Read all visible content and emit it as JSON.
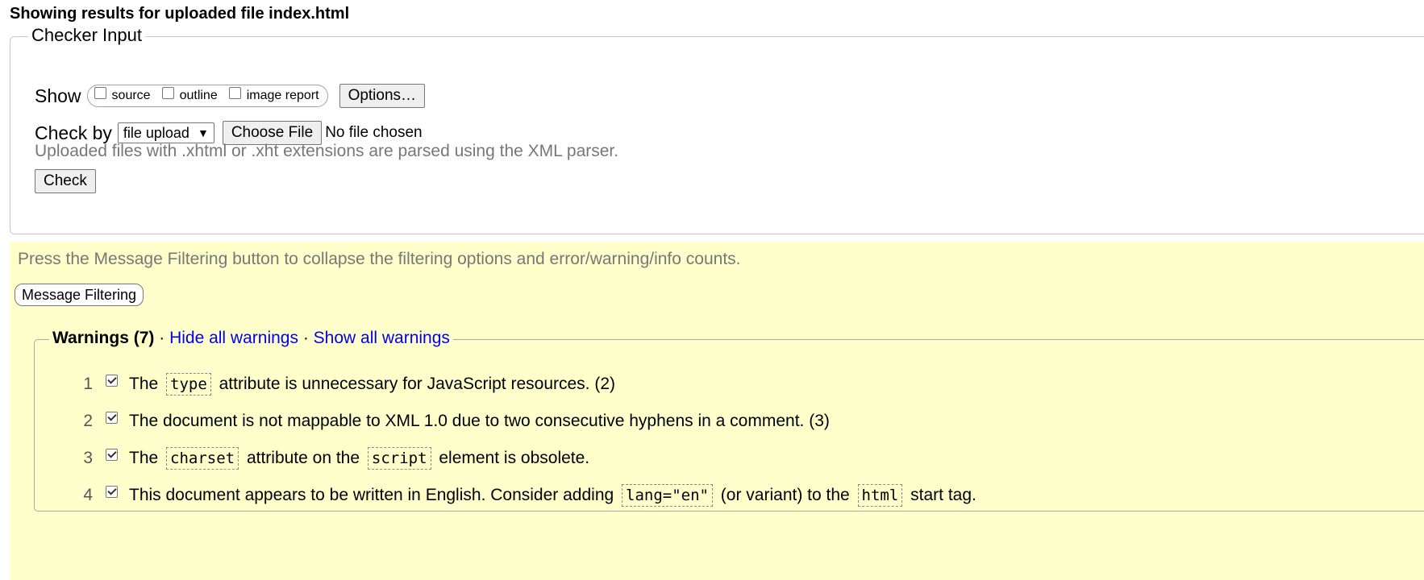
{
  "page": {
    "title_prefix": "Showing results for uploaded file index.html"
  },
  "checker": {
    "legend": "Checker Input",
    "show_label": "Show",
    "show_options": [
      {
        "label": "source",
        "checked": false
      },
      {
        "label": "outline",
        "checked": false
      },
      {
        "label": "image report",
        "checked": false
      }
    ],
    "options_button": "Options…",
    "check_by_label": "Check by",
    "check_by_value": "file upload",
    "choose_file_button": "Choose File",
    "no_file_text": "No file chosen",
    "hint": "Uploaded files with .xhtml or .xht extensions are parsed using the XML parser.",
    "check_button": "Check"
  },
  "filter": {
    "hint": "Press the Message Filtering button to collapse the filtering options and error/warning/info counts.",
    "button": "Message Filtering",
    "warnings_heading": "Warnings (7)",
    "separator": " · ",
    "hide_all": "Hide all warnings",
    "show_all": "Show all warnings",
    "messages": [
      {
        "num": "1",
        "checked": true,
        "parts": [
          "The ",
          "type",
          " attribute is unnecessary for JavaScript resources. (2)"
        ]
      },
      {
        "num": "2",
        "checked": true,
        "parts": [
          "The document is not mappable to XML 1.0 due to two consecutive hyphens in a comment. (3)"
        ]
      },
      {
        "num": "3",
        "checked": true,
        "parts": [
          "The ",
          "charset",
          " attribute on the ",
          "script",
          " element is obsolete."
        ]
      },
      {
        "num": "4",
        "checked": true,
        "parts": [
          "This document appears to be written in English. Consider adding ",
          "lang=\"en\"",
          " (or variant) to the ",
          "html",
          " start tag."
        ]
      }
    ]
  }
}
